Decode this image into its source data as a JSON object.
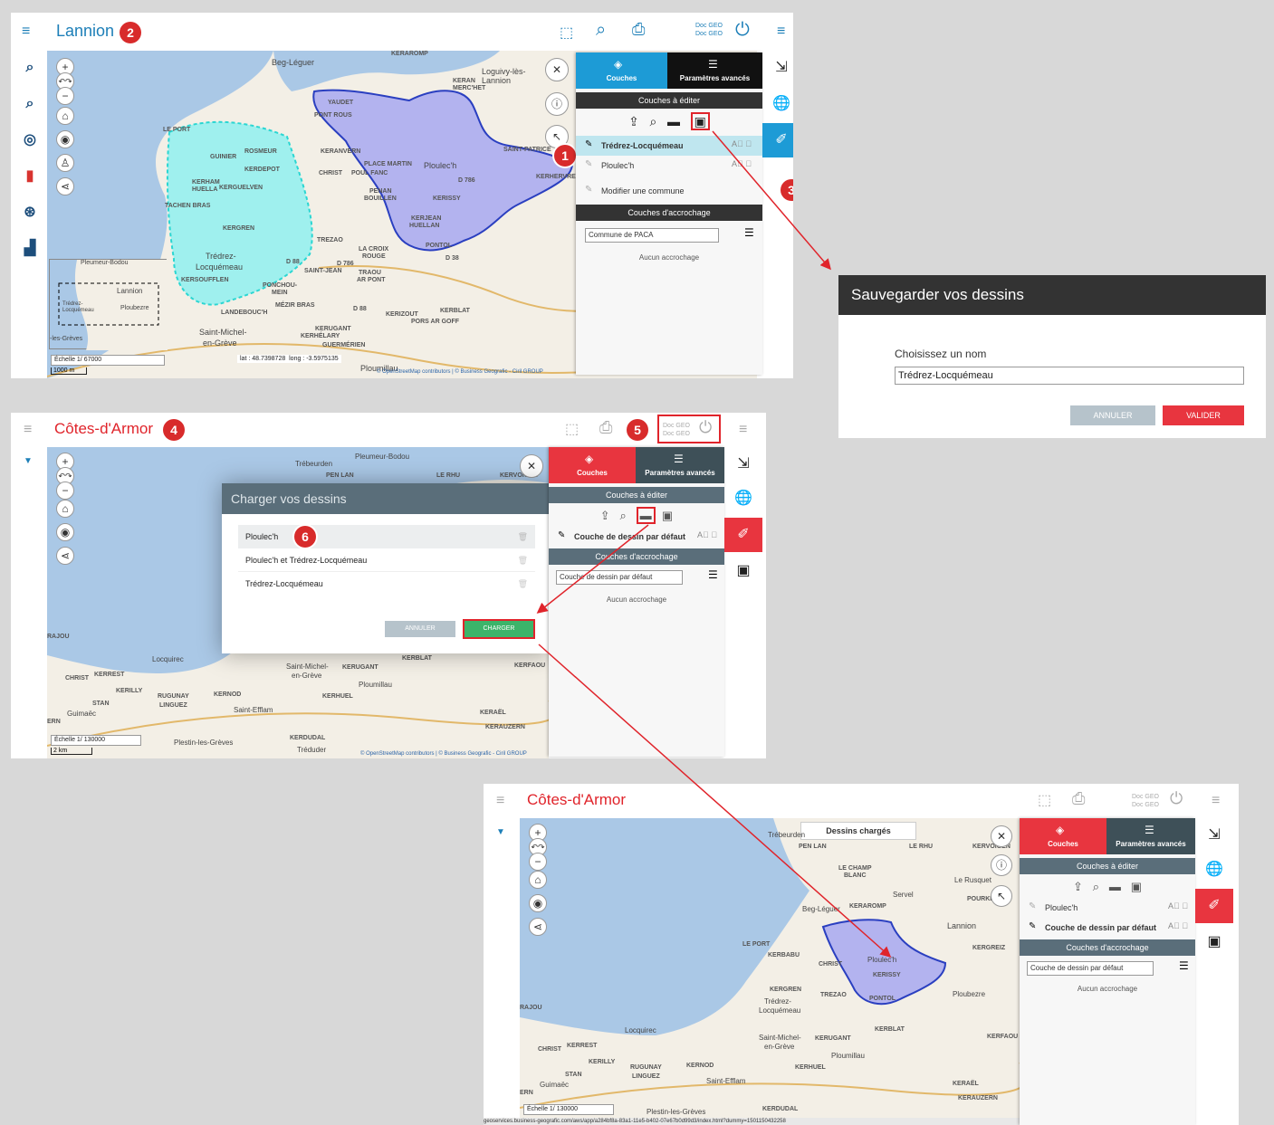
{
  "s1": {
    "title": "Lannion",
    "badges": [
      "1",
      "2",
      "3"
    ],
    "docgeo": [
      "Doc GEO",
      "Doc GEO"
    ],
    "tabs": {
      "layers": "Couches",
      "advanced": "Paramètres avancés"
    },
    "edit_header": "Couches à éditer",
    "layers": [
      "Trédrez-Locquémeau",
      "Ploulec'h"
    ],
    "modify": "Modifier une commune",
    "snap_header": "Couches d'accrochage",
    "snap_select": "Commune de PACA",
    "no_snap": "Aucun accrochage",
    "scale_label": "Échelle 1/",
    "scale_value": "67000",
    "scale_bar": "1000 m",
    "lat_label": "lat :",
    "lat": "48.7398728",
    "long_label": "long :",
    "long": "-3.5975135",
    "attribution": "© OpenStreetMap contributors | © Business Geografic - Ciril GROUP",
    "overview": [
      "Pleumeur-Bodou",
      "Lannion",
      "Trédrez-Locquémeau",
      "Ploubezre",
      "-les-Grèves"
    ],
    "places": [
      "Beg-Léguer",
      "KERAROMP",
      "Loguivy-lès-Lannion",
      "KERAN",
      "MERC'HET",
      "YAUDET",
      "PONT ROUS",
      "LE PORT",
      "ROSMEUR",
      "GUINIER",
      "KERDEPOT",
      "KERHAM",
      "HUELLA",
      "KERGUELVEN",
      "TACHEN BRAS",
      "KERGREN",
      "KERANVERN",
      "PLACE MARTIN",
      "CHRIST",
      "POUL FANC",
      "PENAN",
      "BOUILLEN",
      "Ploulec'h",
      "D 786",
      "KERISSY",
      "KERJEAN",
      "HUELLAN",
      "SAINT-PATRICE",
      "KERHERVRE",
      "TREZAO",
      "LA CROIX",
      "ROUGE",
      "D 786",
      "PONTOL",
      "D 38",
      "Trédrez-",
      "Locquémeau",
      "D 88",
      "SAINT-JEAN",
      "TRAOU",
      "AR PONT",
      "KERSOUFFLEN",
      "PONCHOU-",
      "MEIN",
      "MÉZIR BRAS",
      "LANDEBOUC'H",
      "D 88",
      "KERIZOUT",
      "KERBLAT",
      "PORS AR GOFF",
      "KERUGANT",
      "KERHÉLARY",
      "Saint-Michel-",
      "en-Grève",
      "GUERMÉRIEN",
      "Ploumillau"
    ]
  },
  "dialog_save": {
    "title": "Sauvegarder vos dessins",
    "label": "Choisissez un nom",
    "value": "Trédrez-Locquémeau",
    "cancel": "ANNULER",
    "ok": "VALIDER"
  },
  "s2": {
    "title": "Côtes-d'Armor",
    "badges": [
      "4",
      "5",
      "6"
    ],
    "docgeo": [
      "Doc GEO",
      "Doc GEO"
    ],
    "tabs": {
      "layers": "Couches",
      "advanced": "Paramètres avancés"
    },
    "edit_header": "Couches à éditer",
    "layer": "Couche de dessin par défaut",
    "snap_header": "Couches d'accrochage",
    "snap_select": "Couche de dessin par défaut",
    "no_snap": "Aucun accrochage",
    "scale_label": "Échelle 1/",
    "scale_value": "130000",
    "scale_bar": "2 km",
    "attribution": "© OpenStreetMap contributors | © Business Geografic - Ciril GROUP",
    "load_dialog": {
      "title": "Charger vos dessins",
      "items": [
        "Ploulec'h",
        "Ploulec'h et Trédrez-Locquémeau",
        "Trédrez-Locquémeau"
      ],
      "cancel": "ANNULER",
      "ok": "CHARGER"
    },
    "places": [
      "Trébeurden",
      "PEN LAN",
      "Pleumeur-Bodou",
      "LE RHU",
      "KERVOIGEN",
      "RAJOU",
      "Locquirec",
      "CHRIST",
      "KERREST",
      "KERILLY",
      "STAN",
      "Guimaëc",
      "RUGUNAY",
      "LINGUEZ",
      "KERNOD",
      "Saint-Michel-",
      "en-Grève",
      "KERUGANT",
      "Ploumillau",
      "KERHUEL",
      "Saint-Efflam",
      "KERBLAT",
      "KERFAOU",
      "KERAËL",
      "KERAUZERN",
      "KERDUDAL",
      "Plestin-les-Grèves",
      "Tréduder",
      "ERN"
    ]
  },
  "s3": {
    "title": "Côtes-d'Armor",
    "docgeo": [
      "Doc GEO",
      "Doc GEO"
    ],
    "toast": "Dessins chargés",
    "tabs": {
      "layers": "Couches",
      "advanced": "Paramètres avancés"
    },
    "edit_header": "Couches à éditer",
    "layers": [
      "Ploulec'h",
      "Couche de dessin par défaut"
    ],
    "snap_header": "Couches d'accrochage",
    "snap_select": "Couche de dessin par défaut",
    "no_snap": "Aucun accrochage",
    "scale_label": "Échelle 1/",
    "scale_value": "130000",
    "url": "geoservices.business-geografic.com/aws/app/a284bf8a-83a1-11e5-b402-07e67b0d99d3/index.html?dummy=1501150432258",
    "places": [
      "Trébeurden",
      "PEN LAN",
      "LE CHAMP",
      "BLANC",
      "LE RHU",
      "KERVOIGEN",
      "Le Rusquet",
      "POURKE",
      "Servel",
      "Beg-Léguer",
      "KERAROMP",
      "Lannion",
      "LE PORT",
      "KERBABU",
      "CHRIST",
      "Ploulec'h",
      "KERISSY",
      "KERGREIZ",
      "Ploubezre",
      "KERGREN",
      "TREZAO",
      "PONTOL",
      "Trédrez-",
      "Locquémeau",
      "RAJOU",
      "Locquirec",
      "Saint-Michel-",
      "en-Grève",
      "KERUGANT",
      "KERBLAT",
      "KERFAOU",
      "Ploumillau",
      "CHRIST",
      "KERREST",
      "KERILLY",
      "STAN",
      "Guimaëc",
      "RUGUNAY",
      "LINGUEZ",
      "KERNOD",
      "KERHUEL",
      "Saint-Efflam",
      "KERAËL",
      "KERAUZERN",
      "KERDUDAL",
      "Plestin-les-Grèves",
      "ERN"
    ]
  },
  "colors": {
    "blue": "#1d9bd6",
    "red": "#e8353f",
    "dark": "#222222",
    "slate": "#5a6e7a",
    "green": "#3cb46a",
    "cancel": "#b6c3cb"
  }
}
